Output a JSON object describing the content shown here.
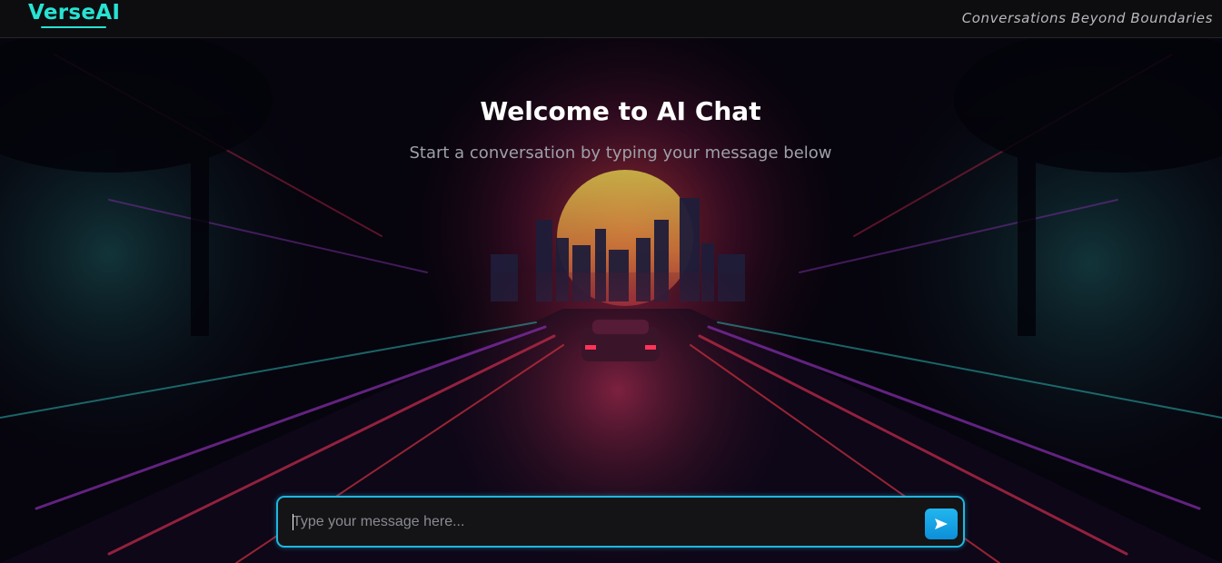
{
  "header": {
    "logo": "VerseAI",
    "tagline": "Conversations Beyond Boundaries"
  },
  "welcome": {
    "title": "Welcome to AI Chat",
    "subtitle": "Start a conversation by typing your message below"
  },
  "chat_input": {
    "placeholder": "Type your message here...",
    "value": "",
    "send_icon": "send-arrow-icon"
  },
  "colors": {
    "accent": "#27e3d3",
    "input_border": "#1fb7e0",
    "send_button": "#0c8fd8",
    "header_bg": "#0e0e10"
  },
  "background": {
    "image": "synthwave-city-highway-sunset-car"
  }
}
